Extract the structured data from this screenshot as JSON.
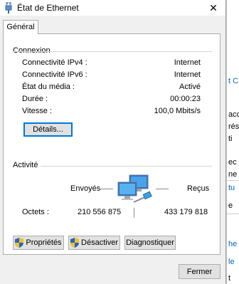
{
  "window": {
    "title": "État de Ethernet",
    "close_symbol": "✕"
  },
  "tabs": [
    {
      "label": "Général"
    }
  ],
  "connection": {
    "title": "Connexion",
    "rows": [
      {
        "label": "Connectivité IPv4 :",
        "value": "Internet"
      },
      {
        "label": "Connectivité IPv6 :",
        "value": "Internet"
      },
      {
        "label": "État du média :",
        "value": "Activé"
      },
      {
        "label": "Durée :",
        "value": "00:00:23"
      },
      {
        "label": "Vitesse :",
        "value": "100,0 Mbits/s"
      }
    ],
    "details_button": "Détails..."
  },
  "activity": {
    "title": "Activité",
    "sent_label": "Envoyés",
    "received_label": "Reçus",
    "octets_label": "Octets :",
    "sent_value": "210 556 875",
    "received_value": "433 179 818",
    "icon": "network-computers-icon"
  },
  "buttons": {
    "properties": "Propriétés",
    "disable": "Désactiver",
    "diagnose": "Diagnostiquer",
    "close": "Fermer"
  },
  "background_window": {
    "fragments": [
      "t C",
      "acc",
      "rés",
      "ti",
      "ec",
      "ne",
      "tu",
      "e",
      "he",
      "le",
      "t"
    ]
  },
  "colors": {
    "accent": "#0078d7",
    "link": "#0066cc"
  }
}
